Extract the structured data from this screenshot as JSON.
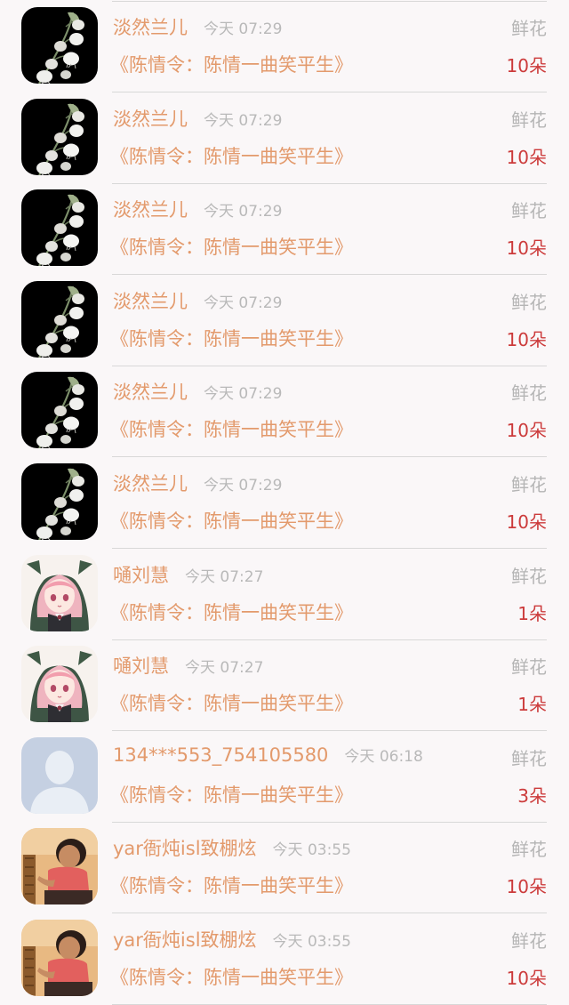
{
  "colors": {
    "background": "#faf7f8",
    "name_text": "#e39a6c",
    "time_text": "#b9b9b9",
    "gift_type_text": "#b5b5b5",
    "count_text": "#cc3b3b",
    "divider": "#d8d8d8"
  },
  "records": [
    {
      "avatar": "lily-flower-avatar",
      "name": "淡然兰儿",
      "time": "今天 07:29",
      "gift_type": "鲜花",
      "book": "《陈情令：陈情一曲笑平生》",
      "count": "10朵"
    },
    {
      "avatar": "lily-flower-avatar",
      "name": "淡然兰儿",
      "time": "今天 07:29",
      "gift_type": "鲜花",
      "book": "《陈情令：陈情一曲笑平生》",
      "count": "10朵"
    },
    {
      "avatar": "lily-flower-avatar",
      "name": "淡然兰儿",
      "time": "今天 07:29",
      "gift_type": "鲜花",
      "book": "《陈情令：陈情一曲笑平生》",
      "count": "10朵"
    },
    {
      "avatar": "lily-flower-avatar",
      "name": "淡然兰儿",
      "time": "今天 07:29",
      "gift_type": "鲜花",
      "book": "《陈情令：陈情一曲笑平生》",
      "count": "10朵"
    },
    {
      "avatar": "lily-flower-avatar",
      "name": "淡然兰儿",
      "time": "今天 07:29",
      "gift_type": "鲜花",
      "book": "《陈情令：陈情一曲笑平生》",
      "count": "10朵"
    },
    {
      "avatar": "lily-flower-avatar",
      "name": "淡然兰儿",
      "time": "今天 07:29",
      "gift_type": "鲜花",
      "book": "《陈情令：陈情一曲笑平生》",
      "count": "10朵"
    },
    {
      "avatar": "anime-girl-avatar",
      "name": "嗵刘慧",
      "time": "今天 07:27",
      "gift_type": "鲜花",
      "book": "《陈情令：陈情一曲笑平生》",
      "count": "1朵"
    },
    {
      "avatar": "anime-girl-avatar",
      "name": "嗵刘慧",
      "time": "今天 07:27",
      "gift_type": "鲜花",
      "book": "《陈情令：陈情一曲笑平生》",
      "count": "1朵"
    },
    {
      "avatar": "default-person-avatar",
      "name": "134***553_754105580",
      "time": "今天 06:18",
      "gift_type": "鲜花",
      "book": "《陈情令：陈情一曲笑平生》",
      "count": "3朵"
    },
    {
      "avatar": "child-photo-avatar",
      "name": "yar衙炖isl致棚炫",
      "time": "今天 03:55",
      "gift_type": "鲜花",
      "book": "《陈情令：陈情一曲笑平生》",
      "count": "10朵"
    },
    {
      "avatar": "child-photo-avatar",
      "name": "yar衙炖isl致棚炫",
      "time": "今天 03:55",
      "gift_type": "鲜花",
      "book": "《陈情令：陈情一曲笑平生》",
      "count": "10朵"
    }
  ]
}
